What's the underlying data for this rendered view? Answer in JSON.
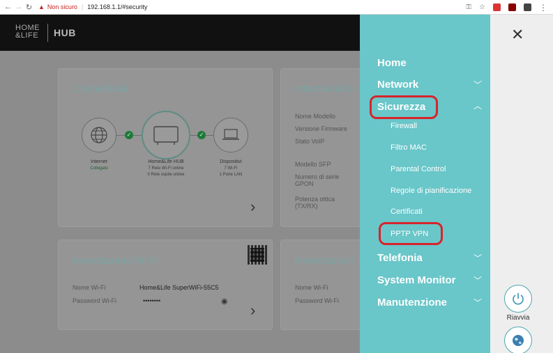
{
  "browser": {
    "insecure_label": "Non sicuro",
    "url": "192.168.1.1/#security"
  },
  "header": {
    "logo_line1": "HOME",
    "logo_line2": "&LIFE",
    "logo_hub": "HUB"
  },
  "connectivity": {
    "title": "Connettività",
    "internet_label": "Internet",
    "internet_status": "Collegato",
    "hub_label": "Home&Life HUB",
    "hub_line1": "7 Rete Wi-Fi online",
    "hub_line2": "0 Rete ospite online",
    "devices_label": "Dispositivi",
    "devices_line1": "7 Wi-Fi",
    "devices_line2": "1 Porte LAN"
  },
  "info": {
    "title": "Informazioni c",
    "fields": [
      "Nome Modello",
      "Versione Firmware",
      "Stato VoIP",
      "Modello SFP",
      "Numero di serie GPON",
      "Potenza ottica (TX/RX)"
    ]
  },
  "wifi": {
    "title": "Impostazioni Wi-Fi",
    "name_label": "Nome Wi-Fi",
    "name_value": "Home&Life SuperWiFi-55C5",
    "password_label": "Password Wi-Fi",
    "password_value": "••••••••"
  },
  "settings2": {
    "title": "Impostazioni",
    "name_label": "Nome Wi-Fi",
    "password_label": "Password Wi-Fi"
  },
  "menu": {
    "home": "Home",
    "network": "Network",
    "sicurezza": "Sicurezza",
    "sub": [
      "Firewall",
      "Filtro MAC",
      "Parental Control",
      "Regole di pianificazione",
      "Certificati",
      "PPTP VPN"
    ],
    "telefonia": "Telefonia",
    "system_monitor": "System Monitor",
    "manutenzione": "Manutenzione"
  },
  "right_panel": {
    "riavvia": "Riavvia"
  },
  "colors": {
    "menu_bg": "#69c6c9",
    "highlight": "#d8232a"
  }
}
